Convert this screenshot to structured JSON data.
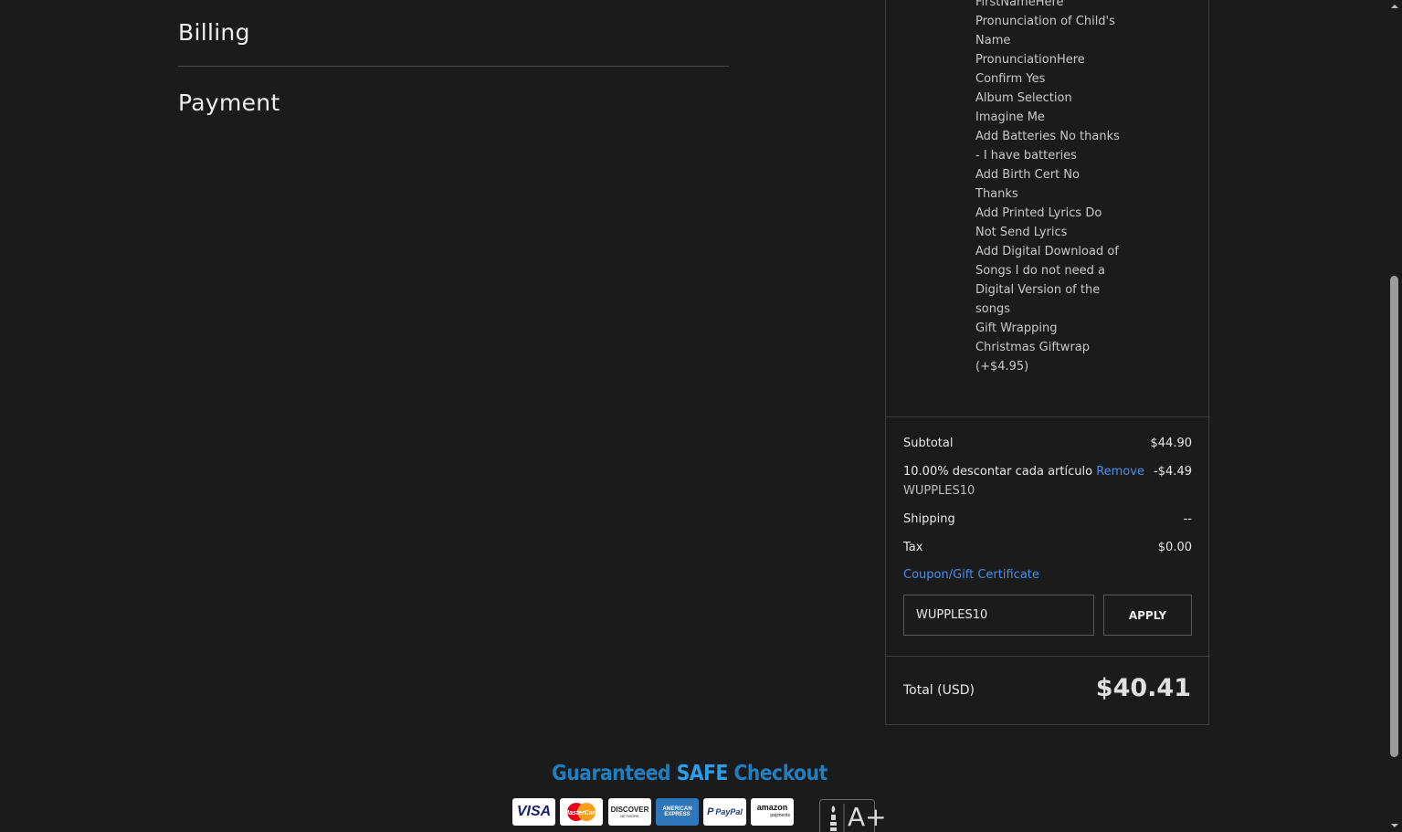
{
  "main": {
    "billing_heading": "Billing",
    "payment_heading": "Payment"
  },
  "cart": {
    "item_options": [
      "FirstNameHere",
      "Pronunciation of Child's Name",
      "PronunciationHere",
      "Confirm Yes",
      "Album Selection",
      "Imagine Me",
      "Add Batteries No thanks - I have batteries",
      "Add Birth Cert No Thanks",
      "Add Printed Lyrics Do Not Send Lyrics",
      "Add Digital Download of Songs I do not need a Digital Version of the songs",
      "Gift Wrapping",
      "Christmas Giftwrap (+$4.95)"
    ],
    "subtotal_label": "Subtotal",
    "subtotal_value": "$44.90",
    "discount_label": "10.00% descontar cada artículo",
    "discount_remove": "Remove",
    "discount_value": "-$4.49",
    "discount_code": "WUPPLES10",
    "shipping_label": "Shipping",
    "shipping_value": "--",
    "tax_label": "Tax",
    "tax_value": "$0.00",
    "coupon_link": "Coupon/Gift Certificate",
    "coupon_input_value": "WUPPLES10",
    "apply_label": "APPLY",
    "total_label": "Total (USD)",
    "total_value": "$40.41"
  },
  "footer": {
    "safe_checkout_part1": "Guaranteed ",
    "safe_checkout_part2": "SAFE",
    "safe_checkout_part3": " Checkout",
    "visa": "VISA",
    "mastercard": "MasterCard",
    "discover": "DISCOVER",
    "discover_sub": "NETWORK",
    "amex_line1": "AMERICAN",
    "amex_line2": "EXPRESS",
    "paypal": "PayPal",
    "amazon": "amazon",
    "amazon_sub": "payments",
    "bbb_rating": "A+"
  },
  "colors": {
    "background": "#1b1b1c",
    "link": "#4a8fe8",
    "safe_checkout_blue": "#1f7fc1"
  }
}
